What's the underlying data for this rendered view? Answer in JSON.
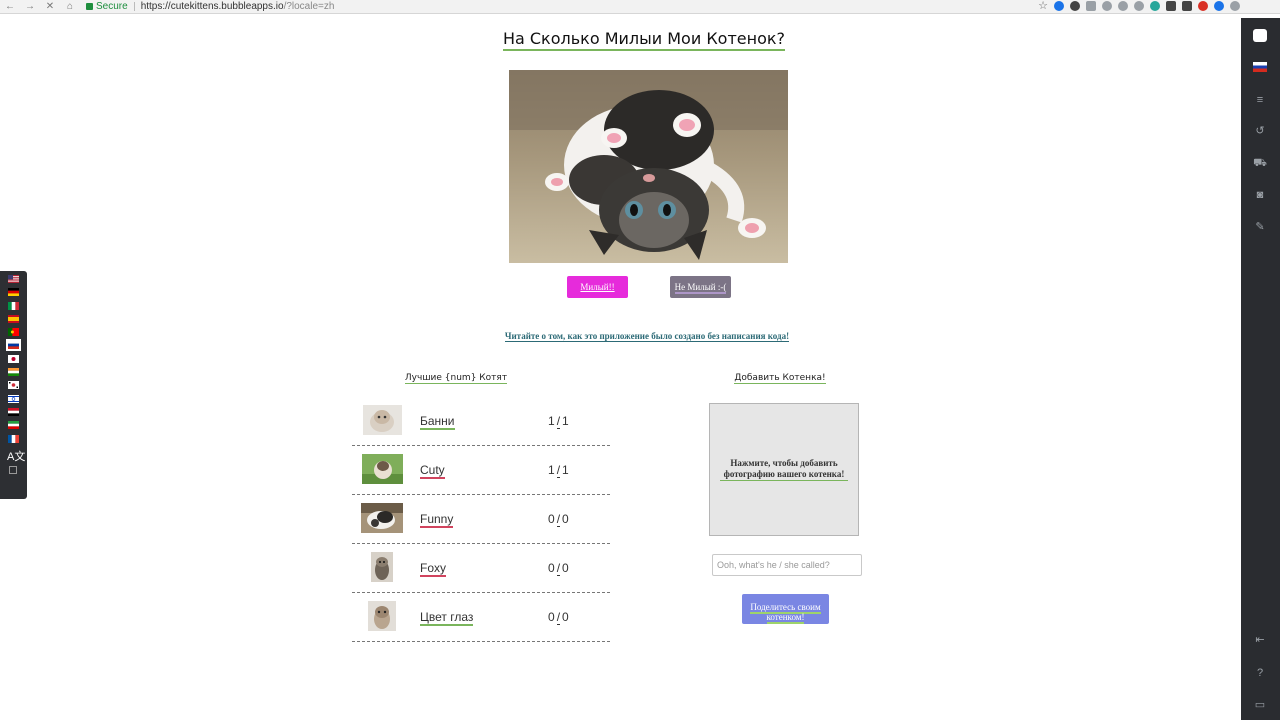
{
  "browser": {
    "secure_label": "Secure",
    "url_host": "https://cutekittens.bubbleapps.io",
    "url_path": "/?locale=zh"
  },
  "page": {
    "title": "На Сколько Милыи Мои Котенок?",
    "cute_button": "Милый!!",
    "not_cute_button": "Не Милый :-(",
    "read_link": "Читайте о том, как это приложение было создано без написания кода!",
    "best_title": "Лучшие {num} Котят",
    "add_title": "Добавить Котенка!"
  },
  "kittens": [
    {
      "name": "Банни",
      "score_a": "1",
      "score_b": "1"
    },
    {
      "name": "Cuty",
      "score_a": "1",
      "score_b": "1"
    },
    {
      "name": "Funny",
      "score_a": "0",
      "score_b": "0"
    },
    {
      "name": "Foxy",
      "score_a": "0",
      "score_b": "0"
    },
    {
      "name": "Цвет глаз",
      "score_a": "0",
      "score_b": "0"
    }
  ],
  "score_separator": "/",
  "upload": {
    "label": "Нажмите, чтобы добавить фотографию вашего котенка!",
    "name_placeholder": "Ooh, what's he / she called?",
    "share_button": "Поделитесь своим котенком!"
  },
  "language_flags": [
    "us",
    "de",
    "it",
    "es",
    "pt",
    "ru",
    "jp",
    "in",
    "kr",
    "il",
    "eg",
    "ir",
    "fr"
  ],
  "active_language": "ru",
  "colors": {
    "cute_button": "#e62bdb",
    "not_cute_button": "#7c7486",
    "share_button": "#7a86e3",
    "accent_green": "#7ab55c",
    "accent_red": "#d1445e"
  }
}
